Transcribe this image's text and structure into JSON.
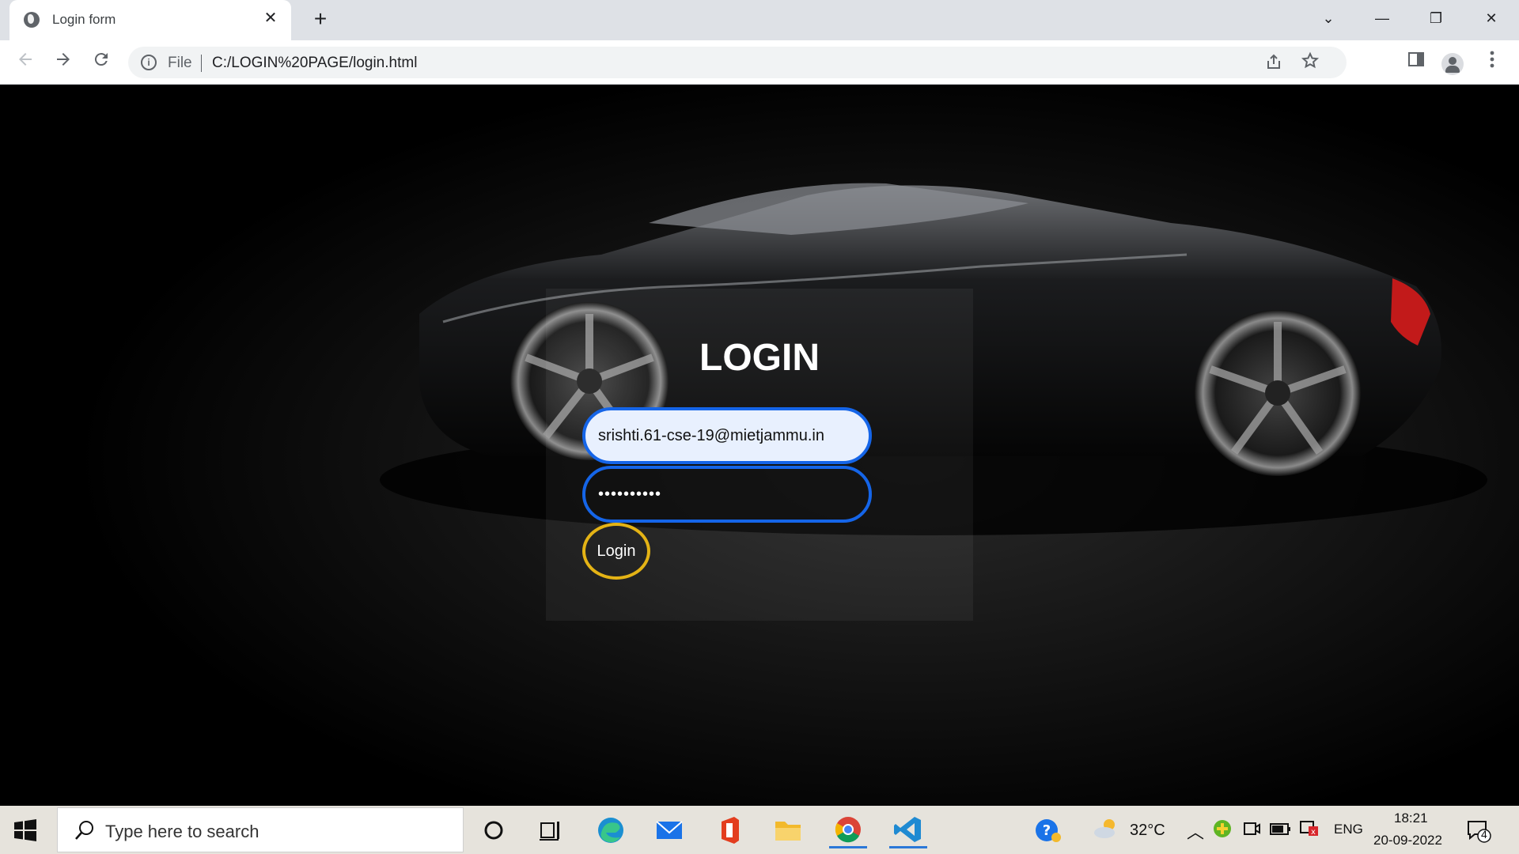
{
  "browser": {
    "tab_title": "Login form",
    "tab_close": "✕",
    "new_tab": "+",
    "address_scheme": "File",
    "address_url": "C:/LOGIN%20PAGE/login.html",
    "window_controls": {
      "dropdown": "⌄",
      "minimize": "—",
      "restore": "❐",
      "close": "✕"
    }
  },
  "page": {
    "heading": "LOGIN",
    "email_value": "srishti.61-cse-19@mietjammu.in",
    "password_value": "••••••••••",
    "login_button": "Login",
    "colors": {
      "field_border": "#1565e8",
      "button_border": "#e4b315",
      "email_bg": "#e8f0fe"
    }
  },
  "taskbar": {
    "search_placeholder": "Type here to search",
    "weather": "32°C",
    "language": "ENG",
    "time": "18:21",
    "date": "20-09-2022",
    "notification_count": "4",
    "apps": [
      "cortana-icon",
      "task-view-icon",
      "edge-icon",
      "mail-icon",
      "office-icon",
      "file-explorer-icon",
      "chrome-icon",
      "vscode-icon"
    ]
  }
}
